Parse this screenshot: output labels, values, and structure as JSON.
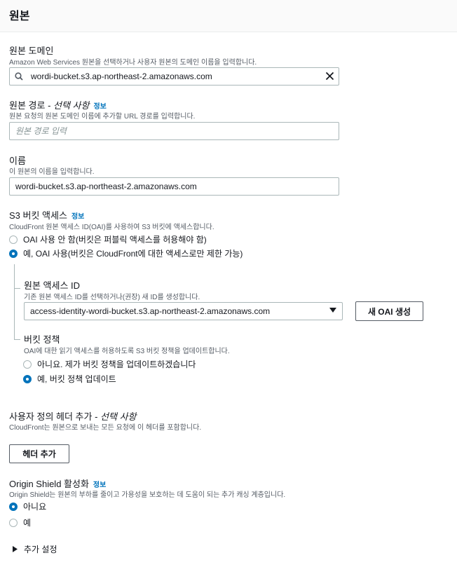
{
  "section": {
    "title": "원본"
  },
  "origin_domain": {
    "label": "원본 도메인",
    "desc": "Amazon Web Services 원본을 선택하거나 사용자 원본의 도메인 이름을 입력합니다.",
    "value": "wordi-bucket.s3.ap-northeast-2.amazonaws.com"
  },
  "origin_path": {
    "label": "원본 경로 - ",
    "optional": "선택 사항",
    "info": "정보",
    "desc": "원본 요청의 원본 도메인 이름에 추가할 URL 경로를 입력합니다.",
    "placeholder": "원본 경로 입력"
  },
  "name": {
    "label": "이름",
    "desc": "이 원본의 이름을 입력합니다.",
    "value": "wordi-bucket.s3.ap-northeast-2.amazonaws.com"
  },
  "s3_access": {
    "label": "S3 버킷 액세스",
    "info": "정보",
    "desc": "CloudFront 원본 액세스 ID(OAI)를 사용하여 S3 버킷에 액세스합니다.",
    "options": [
      {
        "label": "OAI 사용 안 함(버킷은 퍼블릭 액세스를 허용해야 함)",
        "selected": false
      },
      {
        "label": "예, OAI 사용(버킷은 CloudFront에 대한 액세스로만 제한 가능)",
        "selected": true
      }
    ]
  },
  "oai": {
    "label": "원본 액세스 ID",
    "desc": "기존 원본 액세스 ID를 선택하거나(권장) 새 ID를 생성합니다.",
    "value": "access-identity-wordi-bucket.s3.ap-northeast-2.amazonaws.com",
    "new_button": "새 OAI 생성"
  },
  "bucket_policy": {
    "label": "버킷 정책",
    "desc": "OAI에 대한 읽기 액세스를 허용하도록 S3 버킷 정책을 업데이트합니다.",
    "options": [
      {
        "label": "아니요. 제가 버킷 정책을 업데이트하겠습니다",
        "selected": false
      },
      {
        "label": "예, 버킷 정책 업데이트",
        "selected": true
      }
    ]
  },
  "custom_headers": {
    "label": "사용자 정의 헤더 추가 - ",
    "optional": "선택 사항",
    "desc": "CloudFront는 원본으로 보내는 모든 요청에 이 헤더를 포함합니다.",
    "button": "헤더 추가"
  },
  "origin_shield": {
    "label": "Origin Shield 활성화",
    "info": "정보",
    "desc": "Origin Shield는 원본의 부하를 줄이고 가용성을 보호하는 데 도움이 되는 추가 캐싱 계층입니다.",
    "options": [
      {
        "label": "아니요",
        "selected": true
      },
      {
        "label": "예",
        "selected": false
      }
    ]
  },
  "additional_settings": {
    "label": "추가 설정"
  }
}
